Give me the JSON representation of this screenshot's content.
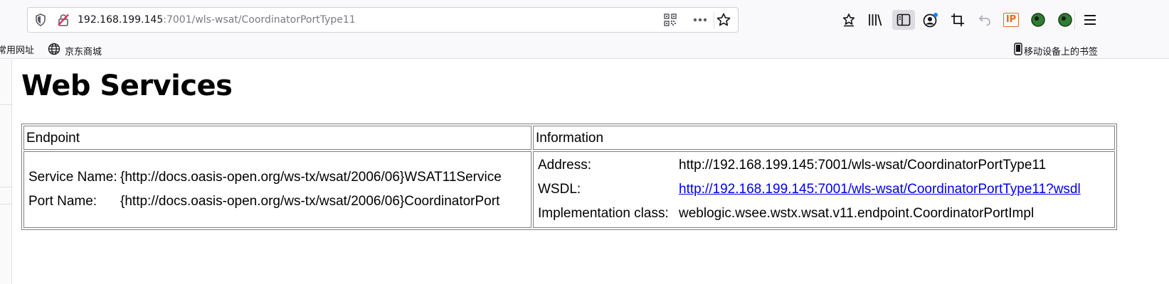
{
  "browser": {
    "url_host": "192.168.199.145",
    "url_path": ":7001/wls-wsat/CoordinatorPortType11",
    "icons": [
      "shield-icon",
      "insecure-lock-icon",
      "qr-code-icon",
      "more-icon",
      "bookmark-star-icon",
      "reader-star-icon",
      "library-icon",
      "sidebar-icon",
      "account-icon",
      "screenshot-icon",
      "undo-icon",
      "ip-extension-icon",
      "extension-icon",
      "extension-icon-2",
      "menu-icon"
    ],
    "ip_label": "IP"
  },
  "bookmarks": {
    "left_items": [
      {
        "label": "常用网址"
      },
      {
        "label": "京东商城",
        "icon": "globe-icon"
      }
    ],
    "mobile": {
      "label": "移动设备上的书签",
      "icon": "phone-icon"
    }
  },
  "page": {
    "title": "Web Services",
    "table": {
      "headers": {
        "endpoint": "Endpoint",
        "information": "Information"
      },
      "endpoint": {
        "service_name_label": "Service Name:",
        "service_name_value": "{http://docs.oasis-open.org/ws-tx/wsat/2006/06}WSAT11Service",
        "port_name_label": "Port Name:",
        "port_name_value": "{http://docs.oasis-open.org/ws-tx/wsat/2006/06}CoordinatorPort"
      },
      "information": {
        "address_label": "Address:",
        "address_value": "http://192.168.199.145:7001/wls-wsat/CoordinatorPortType11",
        "wsdl_label": "WSDL:",
        "wsdl_value": "http://192.168.199.145:7001/wls-wsat/CoordinatorPortType11?wsdl",
        "impl_label": "Implementation class:",
        "impl_value": "weblogic.wsee.wstx.wsat.v11.endpoint.CoordinatorPortImpl"
      }
    }
  },
  "colors": {
    "link": "#0000ee",
    "border": "#808080",
    "ip_badge": "#e66a1e",
    "extension_green": "#2e7d32",
    "notify_dot": "#0a84ff"
  }
}
